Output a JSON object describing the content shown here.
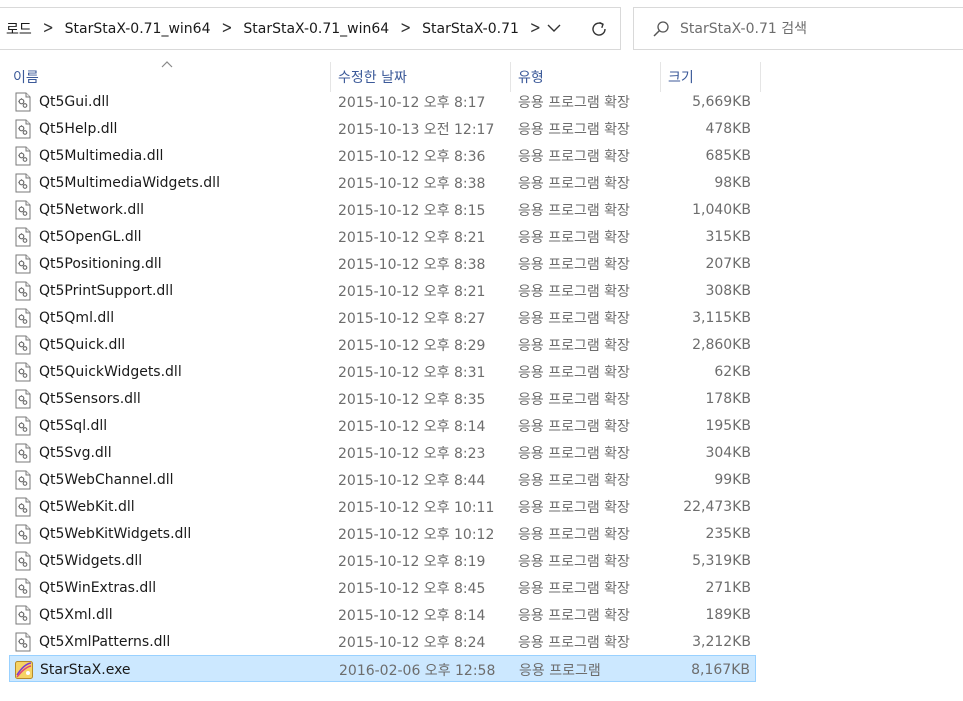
{
  "address_bar": {
    "crumbs": [
      "로드",
      "StarStaX-0.71_win64",
      "StarStaX-0.71_win64",
      "StarStaX-0.71"
    ]
  },
  "search": {
    "placeholder": "StarStaX-0.71 검색"
  },
  "columns": {
    "name": "이름",
    "date": "수정한 날짜",
    "type": "유형",
    "size": "크기"
  },
  "files": [
    {
      "name": "Qt5Gui.dll",
      "date": "2015-10-12 오후 8:17",
      "type": "응용 프로그램 확장",
      "size": "5,669KB",
      "icon": "dll-file-icon"
    },
    {
      "name": "Qt5Help.dll",
      "date": "2015-10-13 오전 12:17",
      "type": "응용 프로그램 확장",
      "size": "478KB",
      "icon": "dll-file-icon"
    },
    {
      "name": "Qt5Multimedia.dll",
      "date": "2015-10-12 오후 8:36",
      "type": "응용 프로그램 확장",
      "size": "685KB",
      "icon": "dll-file-icon"
    },
    {
      "name": "Qt5MultimediaWidgets.dll",
      "date": "2015-10-12 오후 8:38",
      "type": "응용 프로그램 확장",
      "size": "98KB",
      "icon": "dll-file-icon"
    },
    {
      "name": "Qt5Network.dll",
      "date": "2015-10-12 오후 8:15",
      "type": "응용 프로그램 확장",
      "size": "1,040KB",
      "icon": "dll-file-icon"
    },
    {
      "name": "Qt5OpenGL.dll",
      "date": "2015-10-12 오후 8:21",
      "type": "응용 프로그램 확장",
      "size": "315KB",
      "icon": "dll-file-icon"
    },
    {
      "name": "Qt5Positioning.dll",
      "date": "2015-10-12 오후 8:38",
      "type": "응용 프로그램 확장",
      "size": "207KB",
      "icon": "dll-file-icon"
    },
    {
      "name": "Qt5PrintSupport.dll",
      "date": "2015-10-12 오후 8:21",
      "type": "응용 프로그램 확장",
      "size": "308KB",
      "icon": "dll-file-icon"
    },
    {
      "name": "Qt5Qml.dll",
      "date": "2015-10-12 오후 8:27",
      "type": "응용 프로그램 확장",
      "size": "3,115KB",
      "icon": "dll-file-icon"
    },
    {
      "name": "Qt5Quick.dll",
      "date": "2015-10-12 오후 8:29",
      "type": "응용 프로그램 확장",
      "size": "2,860KB",
      "icon": "dll-file-icon"
    },
    {
      "name": "Qt5QuickWidgets.dll",
      "date": "2015-10-12 오후 8:31",
      "type": "응용 프로그램 확장",
      "size": "62KB",
      "icon": "dll-file-icon"
    },
    {
      "name": "Qt5Sensors.dll",
      "date": "2015-10-12 오후 8:35",
      "type": "응용 프로그램 확장",
      "size": "178KB",
      "icon": "dll-file-icon"
    },
    {
      "name": "Qt5Sql.dll",
      "date": "2015-10-12 오후 8:14",
      "type": "응용 프로그램 확장",
      "size": "195KB",
      "icon": "dll-file-icon"
    },
    {
      "name": "Qt5Svg.dll",
      "date": "2015-10-12 오후 8:23",
      "type": "응용 프로그램 확장",
      "size": "304KB",
      "icon": "dll-file-icon"
    },
    {
      "name": "Qt5WebChannel.dll",
      "date": "2015-10-12 오후 8:44",
      "type": "응용 프로그램 확장",
      "size": "99KB",
      "icon": "dll-file-icon"
    },
    {
      "name": "Qt5WebKit.dll",
      "date": "2015-10-12 오후 10:11",
      "type": "응용 프로그램 확장",
      "size": "22,473KB",
      "icon": "dll-file-icon"
    },
    {
      "name": "Qt5WebKitWidgets.dll",
      "date": "2015-10-12 오후 10:12",
      "type": "응용 프로그램 확장",
      "size": "235KB",
      "icon": "dll-file-icon"
    },
    {
      "name": "Qt5Widgets.dll",
      "date": "2015-10-12 오후 8:19",
      "type": "응용 프로그램 확장",
      "size": "5,319KB",
      "icon": "dll-file-icon"
    },
    {
      "name": "Qt5WinExtras.dll",
      "date": "2015-10-12 오후 8:45",
      "type": "응용 프로그램 확장",
      "size": "271KB",
      "icon": "dll-file-icon"
    },
    {
      "name": "Qt5Xml.dll",
      "date": "2015-10-12 오후 8:14",
      "type": "응용 프로그램 확장",
      "size": "189KB",
      "icon": "dll-file-icon"
    },
    {
      "name": "Qt5XmlPatterns.dll",
      "date": "2015-10-12 오후 8:24",
      "type": "응용 프로그램 확장",
      "size": "3,212KB",
      "icon": "dll-file-icon"
    },
    {
      "name": "StarStaX.exe",
      "date": "2016-02-06 오후 12:58",
      "type": "응용 프로그램",
      "size": "8,167KB",
      "icon": "starstax-app-icon",
      "selected": true
    }
  ],
  "colors": {
    "selection_bg": "#cce8ff",
    "selection_border": "#99d1ff",
    "header_text": "#3c5a99"
  }
}
